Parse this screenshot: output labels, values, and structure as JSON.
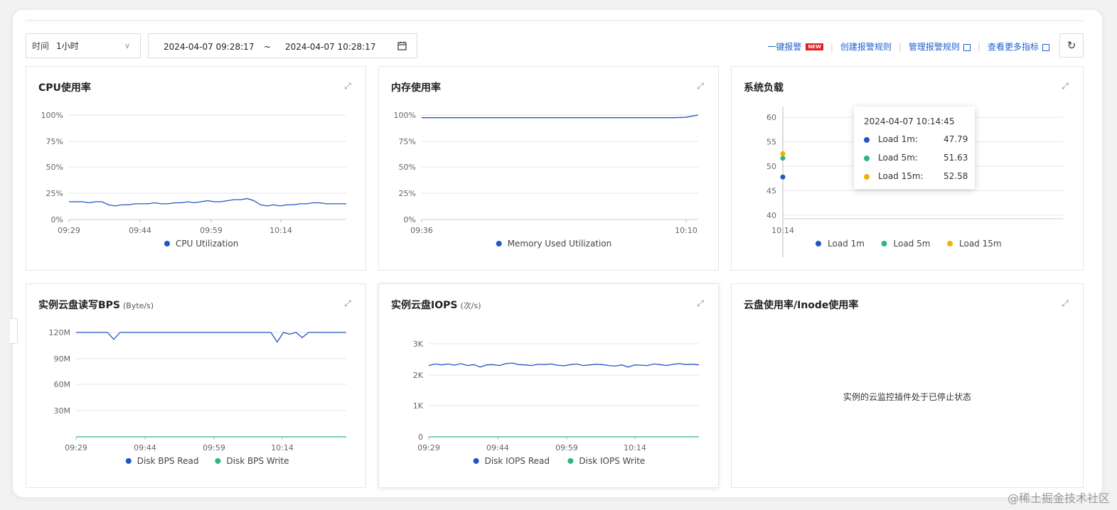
{
  "toolbar": {
    "time_label": "时间",
    "time_value": "1小时",
    "range_start": "2024-04-07 09:28:17",
    "range_sep": "~",
    "range_end": "2024-04-07 10:28:17",
    "new_badge": "NEW",
    "links": [
      "一键报警",
      "创建报警规则",
      "管理报警规则",
      "查看更多指标"
    ]
  },
  "colors": {
    "blue": "#2255c7",
    "green": "#2eb87a",
    "yellow": "#f0b400",
    "grid": "#e6e6e6",
    "link": "#1f5fcc"
  },
  "icons": {
    "calendar": "calendar-icon",
    "refresh": "refresh-icon",
    "expand": "expand-icon",
    "external": "external-link-icon",
    "chevron": "chevron-down-icon"
  },
  "panels": {
    "cpu": {
      "title": "CPU使用率"
    },
    "mem": {
      "title": "内存使用率"
    },
    "load": {
      "title": "系统负载"
    },
    "bps": {
      "title": "实例云盘读写BPS",
      "unit": "(Byte/s)"
    },
    "iops": {
      "title": "实例云盘IOPS",
      "unit": "(次/s)"
    },
    "disk": {
      "title": "云盘使用率/Inode使用率",
      "message": "实例的云监控插件处于已停止状态"
    }
  },
  "tooltip": {
    "time": "2024-04-07 10:14:45",
    "rows": [
      {
        "name": "Load 1m:",
        "value": "47.79"
      },
      {
        "name": "Load 5m:",
        "value": "51.63"
      },
      {
        "name": "Load 15m:",
        "value": "52.58"
      }
    ]
  },
  "chart_data": [
    {
      "id": "cpu",
      "type": "line",
      "title": "CPU使用率",
      "yticks": [
        "100%",
        "75%",
        "50%",
        "25%",
        "0%"
      ],
      "ylim": [
        0,
        100
      ],
      "xticks": [
        "09:29",
        "09:44",
        "09:59",
        "10:14"
      ],
      "legend": "top-less bottom",
      "series": [
        {
          "name": "CPU Utilization",
          "color": "#2255c7",
          "values": [
            17,
            17,
            17,
            16,
            17,
            17,
            14,
            13,
            14,
            14,
            15,
            15,
            15,
            16,
            15,
            15,
            16,
            16,
            17,
            16,
            17,
            18,
            17,
            17,
            18,
            19,
            19,
            20,
            18,
            14,
            13,
            14,
            13,
            14,
            14,
            15,
            15,
            16,
            16,
            15,
            15,
            15,
            15
          ]
        }
      ]
    },
    {
      "id": "mem",
      "type": "line",
      "title": "内存使用率",
      "yticks": [
        "100%",
        "75%",
        "50%",
        "25%",
        "0%"
      ],
      "ylim": [
        0,
        100
      ],
      "xticks": [
        "09:36",
        "10:10"
      ],
      "series": [
        {
          "name": "Memory Used Utilization",
          "color": "#2255c7",
          "values": [
            97.5,
            97.5,
            97.5,
            97.5,
            97.5,
            97.5,
            97.5,
            97.5,
            97.5,
            97.5,
            97.5,
            97.5,
            97.5,
            97.5,
            97.5,
            97.5,
            97.5,
            97.5,
            97.5,
            97.5,
            97.5,
            97.8,
            100
          ]
        }
      ]
    },
    {
      "id": "load",
      "type": "scatter",
      "title": "系统负载",
      "yticks": [
        "60",
        "55",
        "50",
        "45",
        "40"
      ],
      "ylim": [
        37.8,
        62.2
      ],
      "xticks": [
        "10:14"
      ],
      "series": [
        {
          "name": "Load 1m",
          "color": "#2255c7",
          "values": [
            47.79
          ]
        },
        {
          "name": "Load 5m",
          "color": "#2eb87a",
          "values": [
            51.63
          ]
        },
        {
          "name": "Load 15m",
          "color": "#f0b400",
          "values": [
            52.58
          ]
        }
      ]
    },
    {
      "id": "bps",
      "type": "line",
      "title": "实例云盘读写BPS",
      "yticks": [
        "120M",
        "90M",
        "60M",
        "30M"
      ],
      "ylim": [
        0,
        120
      ],
      "xticks": [
        "09:29",
        "09:44",
        "09:59",
        "10:14"
      ],
      "series": [
        {
          "name": "Disk BPS Read",
          "color": "#2255c7",
          "values": [
            120,
            120,
            120,
            120,
            120,
            120,
            112,
            120,
            120,
            120,
            120,
            120,
            120,
            120,
            120,
            120,
            120,
            120,
            120,
            120,
            120,
            120,
            120,
            120,
            120,
            120,
            120,
            120,
            120,
            120,
            120,
            120,
            109,
            120,
            118,
            120,
            114,
            120,
            120,
            120,
            120,
            120,
            120,
            120
          ]
        },
        {
          "name": "Disk BPS Write",
          "color": "#2eb87a",
          "values": [
            0,
            0,
            0,
            0,
            0,
            0,
            0,
            0,
            0,
            0,
            0,
            0,
            0,
            0,
            0,
            0,
            0,
            0,
            0,
            0,
            0,
            0,
            0,
            0,
            0,
            0,
            0,
            0,
            0,
            0,
            0,
            0,
            0,
            0,
            0,
            0,
            0,
            0,
            0,
            0,
            0,
            0,
            0,
            0
          ]
        }
      ]
    },
    {
      "id": "iops",
      "type": "line",
      "title": "实例云盘IOPS",
      "yticks": [
        "3K",
        "2K",
        "1K",
        "0"
      ],
      "ylim": [
        0,
        3000
      ],
      "xticks": [
        "09:29",
        "09:44",
        "09:59",
        "10:14"
      ],
      "series": [
        {
          "name": "Disk IOPS Read",
          "color": "#2255c7",
          "values": [
            2300,
            2350,
            2320,
            2350,
            2310,
            2360,
            2300,
            2330,
            2250,
            2320,
            2330,
            2300,
            2360,
            2380,
            2330,
            2320,
            2300,
            2340,
            2330,
            2350,
            2310,
            2290,
            2330,
            2350,
            2300,
            2320,
            2340,
            2330,
            2300,
            2280,
            2320,
            2250,
            2320,
            2310,
            2300,
            2350,
            2330,
            2300,
            2340,
            2360,
            2330,
            2340,
            2320
          ]
        },
        {
          "name": "Disk IOPS Write",
          "color": "#2eb87a",
          "values": [
            0,
            0,
            0,
            0,
            0,
            0,
            0,
            0,
            0,
            0,
            0,
            0,
            0,
            0,
            0,
            0,
            0,
            0,
            0,
            0,
            0,
            0,
            0,
            0,
            0,
            0,
            0,
            0,
            0,
            0,
            0,
            0,
            0,
            0,
            0,
            0,
            0,
            0,
            0,
            0,
            0,
            0,
            0
          ]
        }
      ]
    }
  ],
  "watermark": "@稀土掘金技术社区"
}
